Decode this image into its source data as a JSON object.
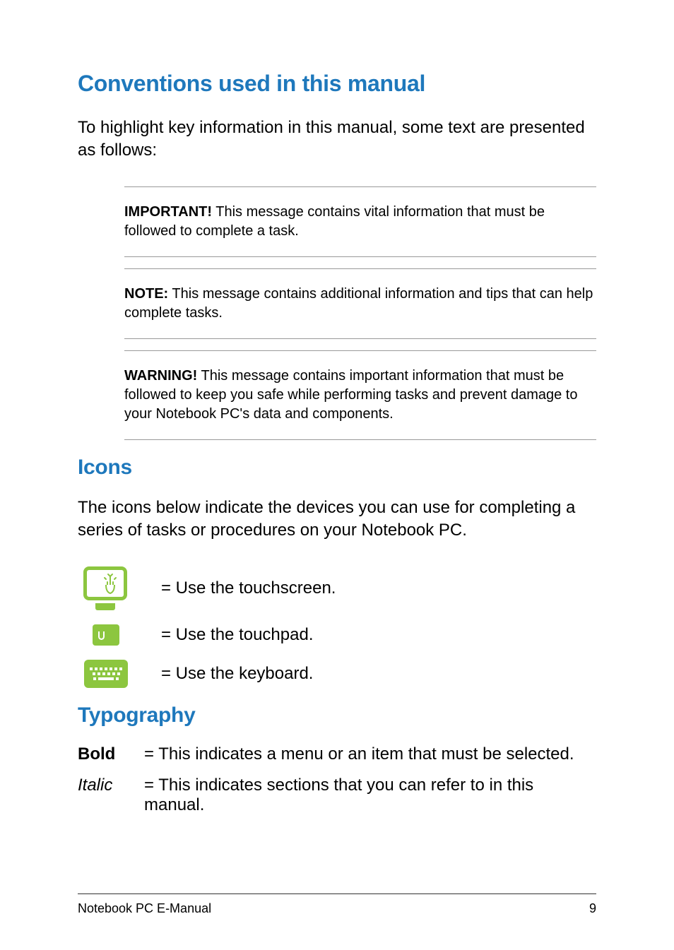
{
  "heading_conventions": "Conventions used in this manual",
  "intro_text": "To highlight key information in this manual, some text are presented as follows:",
  "callouts": [
    {
      "label": "IMPORTANT!",
      "text": " This message contains vital information that must be followed to complete a task."
    },
    {
      "label": "NOTE:",
      "text": " This message contains additional information and tips that can help complete tasks."
    },
    {
      "label": "WARNING!",
      "text": " This message contains important information that must be followed to keep you safe while performing tasks and prevent damage to your Notebook PC's data and components."
    }
  ],
  "heading_icons": "Icons",
  "icons_intro": "The icons below indicate the devices you can use for completing a series of tasks or procedures on your Notebook PC.",
  "icons": [
    {
      "desc": "= Use the touchscreen."
    },
    {
      "desc": "= Use the touchpad."
    },
    {
      "desc": "= Use the keyboard."
    }
  ],
  "heading_typography": "Typography",
  "typography": [
    {
      "label": "Bold",
      "style": "bold",
      "desc": "= This indicates a menu or an item that must be selected."
    },
    {
      "label": "Italic",
      "style": "italic",
      "desc": "= This indicates sections that you can refer to in this manual."
    }
  ],
  "footer_left": "Notebook PC E-Manual",
  "footer_right": "9"
}
